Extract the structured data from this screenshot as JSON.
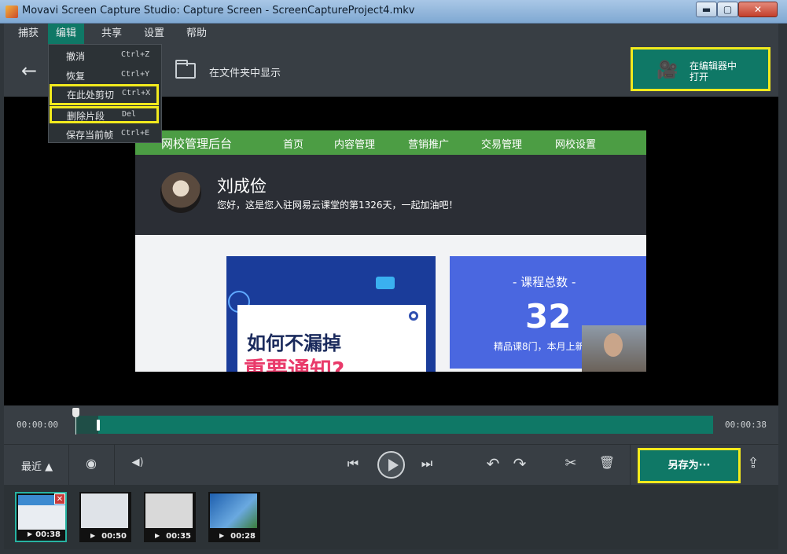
{
  "window": {
    "title": "Movavi Screen Capture Studio: Capture Screen - ScreenCaptureProject4.mkv",
    "minimize": "▬",
    "maximize": "▢",
    "close": "✕"
  },
  "menubar": [
    "捕获",
    "编辑",
    "共享",
    "设置",
    "帮助"
  ],
  "edit_menu": [
    {
      "label": "撤消",
      "shortcut": "Ctrl+Z"
    },
    {
      "label": "恢复",
      "shortcut": "Ctrl+Y"
    },
    {
      "label": "在此处剪切",
      "shortcut": "Ctrl+X"
    },
    {
      "label": "删除片段",
      "shortcut": "Del"
    },
    {
      "label": "保存当前帧",
      "shortcut": "Ctrl+E"
    }
  ],
  "toolbar": {
    "back_icon": "←",
    "show_in_folder": "在文件夹中显示",
    "open_in_editor_line1": "在编辑器中",
    "open_in_editor_line2": "打开"
  },
  "preview": {
    "brand": "网校管理后台",
    "nav": [
      "首页",
      "内容管理",
      "营销推广",
      "交易管理",
      "网校设置"
    ],
    "user_name": "刘成俭",
    "greeting": "您好，这是您入驻网易云课堂的第1326天，一起加油吧！",
    "banner_line1": "如何不漏掉",
    "banner_line2": "重要通知?",
    "stat_title": "- 课程总数 -",
    "stat_value": "32",
    "stat_sub": "精品课8门，本月上新"
  },
  "timeline": {
    "start": "00:00:00",
    "end": "00:00:38",
    "trim_position": 0.0
  },
  "controls": {
    "recent": "最近 ▲",
    "save_as": "另存为···",
    "icons": {
      "camera": "◉",
      "volume": "◀)",
      "prev": "⏮",
      "next": "⏭",
      "undo": "↶",
      "redo": "↷",
      "cut": "✂",
      "delete": "🗑",
      "share": "⇪"
    }
  },
  "thumbnails": [
    {
      "duration": "00:38",
      "selected": true
    },
    {
      "duration": "00:50",
      "selected": false
    },
    {
      "duration": "00:35",
      "selected": false
    },
    {
      "duration": "00:28",
      "selected": false
    }
  ],
  "colors": {
    "accent": "#0f7866",
    "highlight": "#f2ea1d",
    "web_green": "#4c9d44"
  }
}
